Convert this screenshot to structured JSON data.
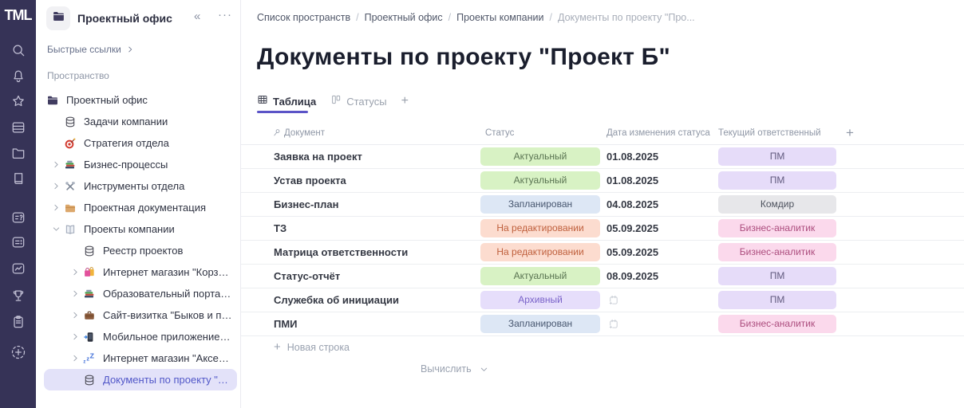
{
  "rail": {
    "logo": "TML",
    "icons": [
      "search",
      "bell",
      "star",
      "cards",
      "folder",
      "book",
      "card-question",
      "card-dots",
      "chart",
      "trophy",
      "clipboard",
      "plus-dashed"
    ],
    "bg_color": "#363357"
  },
  "sidebar": {
    "header": {
      "title": "Проектный офис",
      "icon": "folder-dark",
      "collapse": "«",
      "menu": "···"
    },
    "quick_links_label": "Быстрые ссылки",
    "section_label": "Пространство",
    "selected_bg": "#e3e2f9",
    "selected_text": "#5157c8",
    "tree": [
      {
        "label": "Проектный офис",
        "icon": "folder-dark",
        "level": 1,
        "chevron": null,
        "selected": false
      },
      {
        "label": "Задачи компании",
        "icon": "database",
        "level": 2,
        "chevron": null,
        "selected": false
      },
      {
        "label": "Стратегия отдела",
        "icon": "target",
        "level": 2,
        "chevron": null,
        "selected": false
      },
      {
        "label": "Бизнес-процессы",
        "icon": "books",
        "level": 2,
        "chevron": "right",
        "selected": false
      },
      {
        "label": "Инструменты отдела",
        "icon": "tools",
        "level": 2,
        "chevron": "right",
        "selected": false
      },
      {
        "label": "Проектная документация",
        "icon": "folder-tan",
        "level": 2,
        "chevron": "right",
        "selected": false
      },
      {
        "label": "Проекты компании",
        "icon": "book-open",
        "level": 2,
        "chevron": "down",
        "selected": false
      },
      {
        "label": "Реестр проектов",
        "icon": "database",
        "level": 3,
        "chevron": null,
        "selected": false
      },
      {
        "label": "Интернет магазин \"Корзина\"",
        "icon": "shopping-bags",
        "level": 3,
        "chevron": "right",
        "selected": false
      },
      {
        "label": "Образовательный портал \"Edu...",
        "icon": "books",
        "level": 3,
        "chevron": "right",
        "selected": false
      },
      {
        "label": "Сайт-визитка \"Быков и партнер...",
        "icon": "briefcase",
        "level": 3,
        "chevron": "right",
        "selected": false
      },
      {
        "label": "Мобильное приложение \"Связь\"",
        "icon": "phone",
        "level": 3,
        "chevron": "right",
        "selected": false
      },
      {
        "label": "Интернет магазин \"Аксессуары\"",
        "icon": "zzz",
        "level": 3,
        "chevron": "right",
        "selected": false
      },
      {
        "label": "Документы по проекту \"Прое...",
        "icon": "database",
        "level": 3,
        "chevron": null,
        "selected": true
      }
    ]
  },
  "breadcrumb": {
    "separator": "/",
    "items": [
      "Список пространств",
      "Проектный офис",
      "Проекты компании",
      "Документы по проекту \"Про..."
    ]
  },
  "page": {
    "title": "Документы по проекту \"Проект Б\""
  },
  "tabs": {
    "underline_color": "#5b54c7",
    "add_label": "+",
    "items": [
      {
        "label": "Таблица",
        "icon": "grid-table",
        "active": true
      },
      {
        "label": "Статусы",
        "icon": "kanban",
        "active": false
      }
    ]
  },
  "table": {
    "columns": [
      "Документ",
      "Статус",
      "Дата изменения статуса",
      "Текущий ответственный"
    ],
    "add_column_label": "+",
    "new_row_label": "Новая строка",
    "compute_label": "Вычислить",
    "rows": [
      {
        "document": "Заявка на проект",
        "status": "Актуальный",
        "status_color": "green",
        "date": "01.08.2025",
        "responsible": "ПМ",
        "responsible_color": "lavender"
      },
      {
        "document": "Устав проекта",
        "status": "Актуальный",
        "status_color": "green",
        "date": "01.08.2025",
        "responsible": "ПМ",
        "responsible_color": "lavender"
      },
      {
        "document": "Бизнес-план",
        "status": "Запланирован",
        "status_color": "blue",
        "date": "04.08.2025",
        "responsible": "Комдир",
        "responsible_color": "gray"
      },
      {
        "document": "ТЗ",
        "status": "На редактировании",
        "status_color": "salmon",
        "date": "05.09.2025",
        "responsible": "Бизнес-аналитик",
        "responsible_color": "pink"
      },
      {
        "document": "Матрица ответственности",
        "status": "На редактировании",
        "status_color": "salmon",
        "date": "05.09.2025",
        "responsible": "Бизнес-аналитик",
        "responsible_color": "pink"
      },
      {
        "document": "Статус-отчёт",
        "status": "Актуальный",
        "status_color": "green",
        "date": "08.09.2025",
        "responsible": "ПМ",
        "responsible_color": "lavender"
      },
      {
        "document": "Служебка об инициации",
        "status": "Архивный",
        "status_color": "purple",
        "date": null,
        "responsible": "ПМ",
        "responsible_color": "lavender"
      },
      {
        "document": "ПМИ",
        "status": "Запланирован",
        "status_color": "blue",
        "date": null,
        "responsible": "Бизнес-аналитик",
        "responsible_color": "pink"
      }
    ]
  },
  "palette": {
    "green": {
      "bg": "#d8f2c4",
      "text": "#5a7452"
    },
    "blue": {
      "bg": "#dde7f5",
      "text": "#47566f"
    },
    "salmon": {
      "bg": "#fcdccf",
      "text": "#bf5f3c"
    },
    "purple": {
      "bg": "#e6defb",
      "text": "#7a63c9"
    },
    "lavender": {
      "bg": "#e6dcf9",
      "text": "#615a7e"
    },
    "gray": {
      "bg": "#e7e7ea",
      "text": "#4d525e"
    },
    "pink": {
      "bg": "#fbd9ec",
      "text": "#ac4d7e"
    }
  }
}
